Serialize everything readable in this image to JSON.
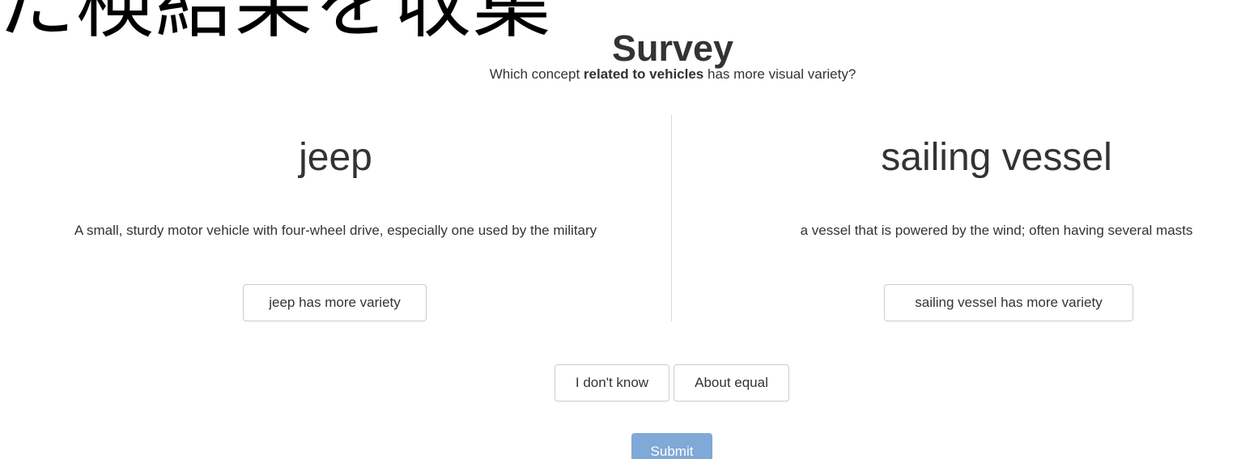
{
  "overlay": {
    "text": "た検結果を収集"
  },
  "header": {
    "title": "Survey"
  },
  "question": {
    "prefix": "Which concept ",
    "bold": "related to vehicles",
    "suffix": " has more visual variety?"
  },
  "concepts": [
    {
      "name": "jeep",
      "description": "A small, sturdy motor vehicle with four-wheel drive, especially one used by the military",
      "button_label": "jeep has more variety"
    },
    {
      "name": "sailing vessel",
      "description": "a vessel that is powered by the wind; often having several masts",
      "button_label": "sailing vessel has more variety"
    }
  ],
  "actions": {
    "unknown_label": "I don't know",
    "equal_label": "About equal",
    "submit_label": "Submit"
  },
  "colors": {
    "submit_bg": "#7fa9d6",
    "text": "#333333",
    "divider": "#d9d9d9"
  }
}
